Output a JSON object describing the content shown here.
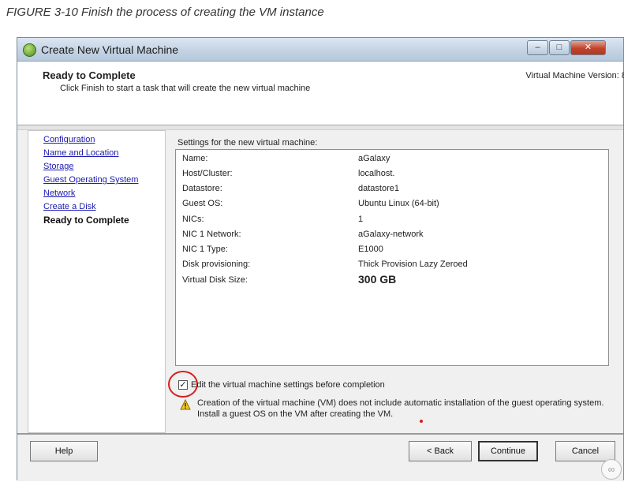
{
  "figure_caption": "FIGURE 3-10  Finish the process of creating the VM instance",
  "window": {
    "title": "Create New Virtual Machine",
    "icon": "vsphere-app-icon"
  },
  "header": {
    "title": "Ready to Complete",
    "subtitle": "Click Finish to start a task that will create the new virtual machine",
    "vm_version": "Virtual Machine Version: 8"
  },
  "nav": {
    "items": [
      {
        "label": "Configuration",
        "active": false
      },
      {
        "label": "Name and Location",
        "active": false
      },
      {
        "label": "Storage",
        "active": false
      },
      {
        "label": "Guest Operating System",
        "active": false
      },
      {
        "label": "Network",
        "active": false
      },
      {
        "label": "Create a Disk",
        "active": false
      },
      {
        "label": "Ready to Complete",
        "active": true
      }
    ]
  },
  "settings": {
    "heading": "Settings for the new virtual machine:",
    "rows": [
      {
        "label": "Name:",
        "value": "aGalaxy"
      },
      {
        "label": "Host/Cluster:",
        "value": "localhost."
      },
      {
        "label": "Datastore:",
        "value": "datastore1"
      },
      {
        "label": "Guest OS:",
        "value": "Ubuntu Linux (64-bit)"
      },
      {
        "label": "NICs:",
        "value": "1"
      },
      {
        "label": "NIC 1 Network:",
        "value": "aGalaxy-network"
      },
      {
        "label": "NIC 1 Type:",
        "value": "E1000"
      },
      {
        "label": "Disk provisioning:",
        "value": "Thick Provision Lazy Zeroed"
      },
      {
        "label": "Virtual Disk Size:",
        "value": "300 GB"
      }
    ]
  },
  "edit_checkbox": {
    "label": "Edit the virtual machine settings before completion",
    "checked": true
  },
  "warning": {
    "text": "Creation of the virtual machine (VM) does not include automatic installation of the guest operating system. Install a guest OS on the VM after creating the VM."
  },
  "buttons": {
    "help": "Help",
    "back": "< Back",
    "continue": "Continue",
    "cancel": "Cancel"
  },
  "colors": {
    "link": "#1a1ab0",
    "annotation_red": "#d42020",
    "close_button": "#c0442b"
  }
}
